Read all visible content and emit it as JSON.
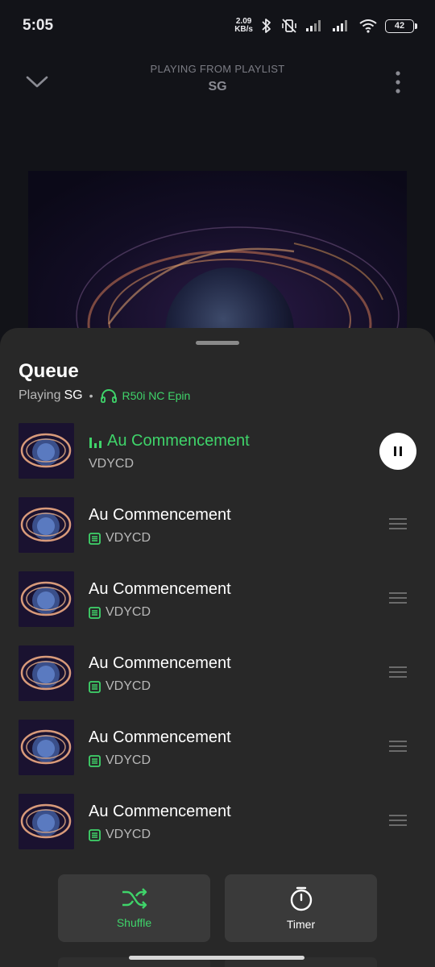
{
  "status_bar": {
    "time": "5:05",
    "net_speed_value": "2.09",
    "net_speed_unit": "KB/s",
    "battery": "42"
  },
  "header": {
    "playing_from": "PLAYING FROM PLAYLIST",
    "playlist": "SG"
  },
  "queue": {
    "title": "Queue",
    "playing_label": "Playing",
    "playlist": "SG",
    "separator": "•",
    "device": "R50i NC Epin",
    "now_playing": {
      "title": "Au Commencement",
      "artist": "VDYCD"
    },
    "items": [
      {
        "title": "Au Commencement",
        "artist": "VDYCD"
      },
      {
        "title": "Au Commencement",
        "artist": "VDYCD"
      },
      {
        "title": "Au Commencement",
        "artist": "VDYCD"
      },
      {
        "title": "Au Commencement",
        "artist": "VDYCD"
      },
      {
        "title": "Au Commencement",
        "artist": "VDYCD"
      }
    ]
  },
  "actions": {
    "shuffle_label": "Shuffle",
    "timer_label": "Timer"
  },
  "colors": {
    "accent_green": "#3fd46a",
    "sheet_bg": "#282828",
    "page_bg": "#121318"
  }
}
